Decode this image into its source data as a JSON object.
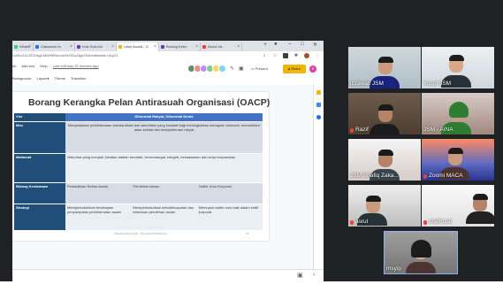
{
  "browser": {
    "tabs": [
      {
        "label": "Whats",
        "color": "#25d366"
      },
      {
        "label": "Classwork fo",
        "color": "#1a73e8"
      },
      {
        "label": "Kuiz Sub-Mo",
        "color": "#673ab7"
      },
      {
        "label": "Latar Award - G",
        "color": "#f4b400"
      },
      {
        "label": "Borang Kebo",
        "color": "#673ab7"
      },
      {
        "label": "About Us",
        "color": "#ea4335"
      }
    ],
    "new_tab": "+",
    "controls": {
      "minimize": "–",
      "maximize": "□",
      "close": "✕"
    },
    "url": "/1aSvGXL2E1hkgCkbWWKkhotuSkYlDuZfghZKsI/edit#slide=id.p21"
  },
  "slides_app": {
    "menu": [
      "ub",
      "Add-ons",
      "Help"
    ],
    "last_edit": "Last edit was 29 minutes ago",
    "toolbar": [
      "Background",
      "Layout▾",
      "Theme",
      "Transition"
    ],
    "present_label": "Present",
    "share_label": "Share",
    "user_initial": "S",
    "collaborator_colors": [
      "#5f8f5f",
      "#f28b82",
      "#c58af9",
      "#81c995",
      "#fdd663",
      "#78d9ec"
    ]
  },
  "slide": {
    "title": "Borang Kerangka Pelan Antirasuah Organisasi (OACP)",
    "rows": [
      {
        "label": "Visi",
        "cells": [
          "Dihormati Rakyat, Dihormati Dunia"
        ]
      },
      {
        "label": "Misi",
        "cells": [
          "Menyediakan perkhidmatan standardisasi dan akreditasi yang kondisif bagi meningkatkan kemajuan ekonomi, memelihara alam sekitar dan kesejahteraan rakyat"
        ]
      },
      {
        "label": "Matlamat",
        "cells": [
          "Nilai-nilai yang menjadi Jabatan adalah beradab, bersemangat, integriti, berwawasan dan kerja berpasukan"
        ]
      },
      {
        "label": "Bidang Keutamaan",
        "cells": [
          "Pentadbiran Sektor Awam",
          "Perolehan Awam",
          "Tadbir Urus Korporat"
        ]
      },
      {
        "label": "Strategi",
        "cells": [
          "Memperkukuhkan kecekapan penyampaian perkhidmatan awam",
          "Memperkukuhkan kebolehcapaian dan ketelusan perolehan awam",
          "Memupuk tadbir urus baik dalam entiti korporat"
        ]
      }
    ],
    "footer": "BAHAGIAN AKAUN · PELAN ANTIRASUAH",
    "page": "16"
  },
  "participants": [
    {
      "name": "izzawati JSM",
      "mic_off": false
    },
    {
      "name": "Yusof JSM",
      "mic_off": false
    },
    {
      "name": "Razif",
      "mic_off": true
    },
    {
      "name": "JSM - AINA",
      "mic_off": false
    },
    {
      "name": "JSM Shafiq Zaka...",
      "mic_off": false
    },
    {
      "name": "Zoomi MACA",
      "mic_off": true
    },
    {
      "name": "asrul",
      "mic_off": true
    },
    {
      "name": "shafinzal",
      "mic_off": true
    },
    {
      "name": "msyip",
      "mic_off": false
    }
  ],
  "colors": {
    "table_header": "#4472c4",
    "table_label": "#1f4e79",
    "share_button": "#f4b400",
    "tile_border": "#8ab4f8"
  }
}
